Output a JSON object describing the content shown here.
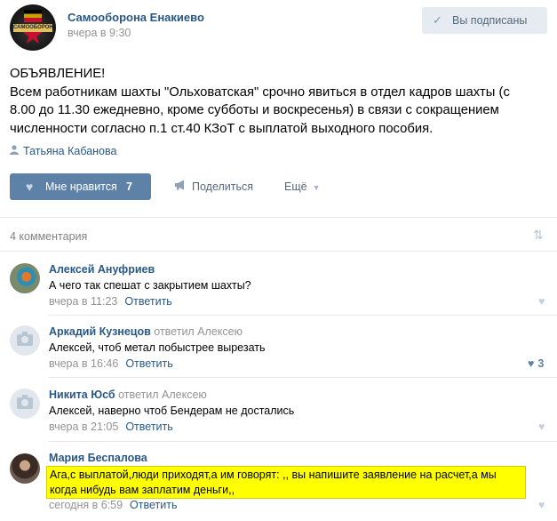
{
  "post": {
    "group_name": "Самооборона Енакиево",
    "time": "вчера в 9:30",
    "avatar_text": "САМООБОРОНА ЕНАКИЕВО",
    "subscribe_label": "Вы подписаны",
    "text_lines": [
      "ОБЪЯВЛЕНИЕ!",
      "Всем работникам шахты \"Ольховатская\" срочно явиться в отдел кадров шахты (с",
      "8.00 до 11.30 ежедневно, кроме субботы и воскресенья) в связи с сокращением",
      "численности согласно п.1 ст.40 КЗоТ с выплатой выходного пособия."
    ],
    "author": "Татьяна Кабанова",
    "like_label": "Мне нравится",
    "like_count": "7",
    "share_label": "Поделиться",
    "more_label": "Ещё"
  },
  "comments_header": "4 комментария",
  "comments": [
    {
      "name": "Алексей Ануфриев",
      "reply_to": "",
      "text": "А чего так спешат с закрытием шахты?",
      "time": "вчера в 11:23",
      "reply_label": "Ответить",
      "likes": ""
    },
    {
      "name": "Аркадий Кузнецов",
      "reply_to": "ответил Алексею",
      "text": "Алексей, чтоб метал побыстрее вырезать",
      "time": "вчера в 16:46",
      "reply_label": "Ответить",
      "likes": "3"
    },
    {
      "name": "Никита Юсб",
      "reply_to": "ответил Алексею",
      "text": "Алексей, наверно чтоб Бендерам не достались",
      "time": "вчера в 21:05",
      "reply_label": "Ответить",
      "likes": ""
    },
    {
      "name": "Мария Беспалова",
      "reply_to": "",
      "text": "Ага,с выплатой,люди приходят,а им говорят: ,, вы напишите заявление на расчет,а мы когда нибудь вам заплатим деньги,,",
      "time": "сегодня в 6:59",
      "reply_label": "Ответить",
      "likes": ""
    }
  ],
  "colors": {
    "link": "#2a5885",
    "button": "#5e81a8",
    "highlight": "#ffff00"
  }
}
